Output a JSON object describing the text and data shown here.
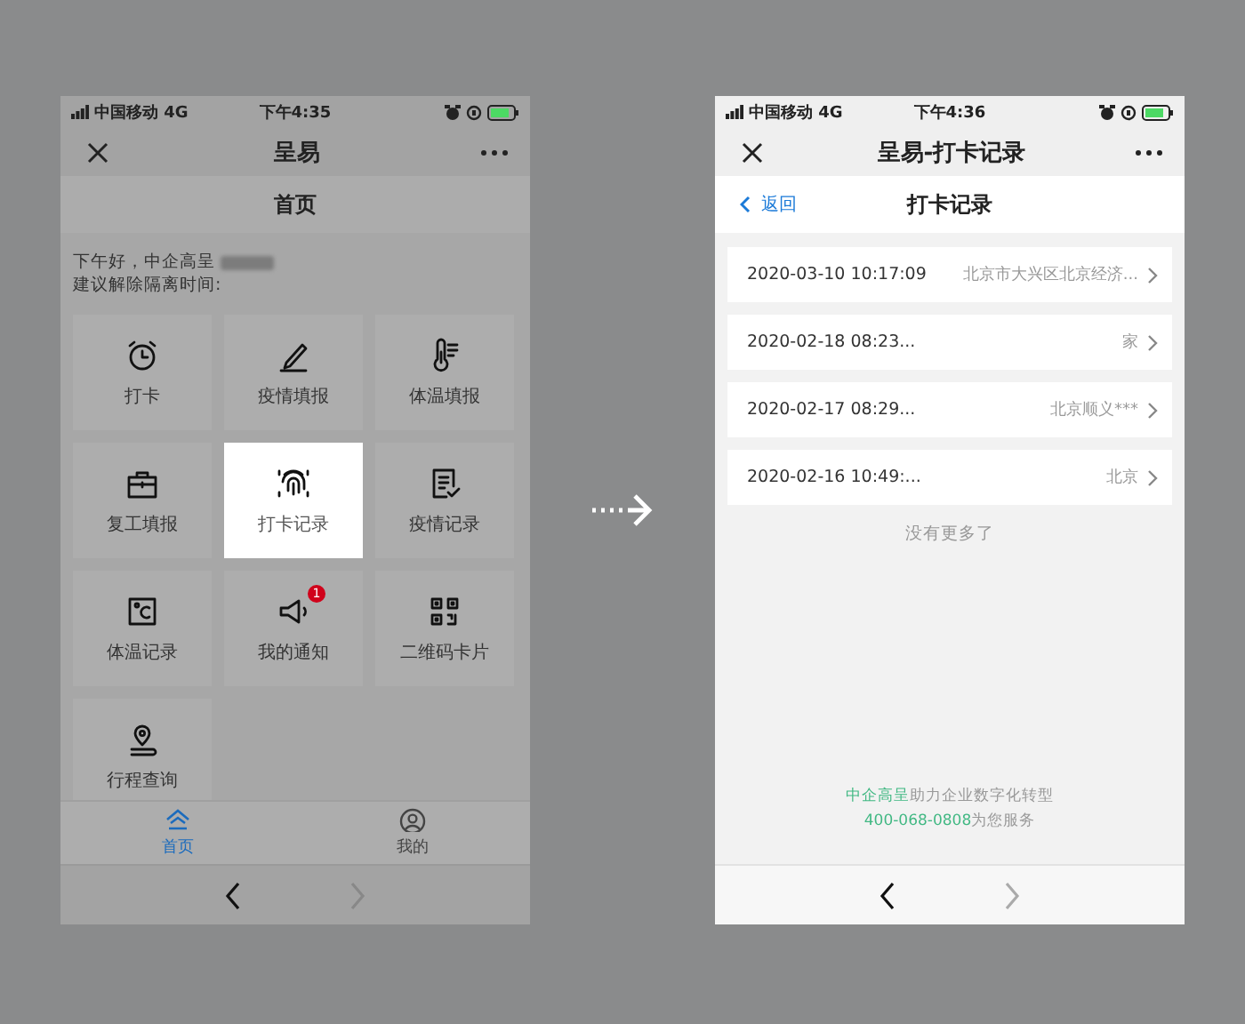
{
  "screens": [
    {
      "kind": "home",
      "dimmed": true,
      "status_bar": {
        "carrier": "中国移动 4G",
        "time": "下午4:35"
      },
      "title": "呈易",
      "nav_title": "首页",
      "greeting": "下午好，中企高呈",
      "advice": "建议解除隔离时间:",
      "tiles": [
        {
          "label": "打卡",
          "highlighted": false
        },
        {
          "label": "疫情填报",
          "highlighted": false
        },
        {
          "label": "体温填报",
          "highlighted": false
        },
        {
          "label": "复工填报",
          "highlighted": false
        },
        {
          "label": "打卡记录",
          "highlighted": true
        },
        {
          "label": "疫情记录",
          "highlighted": false
        },
        {
          "label": "体温记录",
          "highlighted": false
        },
        {
          "label": "我的通知",
          "highlighted": false,
          "badge": "1"
        },
        {
          "label": "二维码卡片",
          "highlighted": false
        },
        {
          "label": "行程查询",
          "highlighted": false
        }
      ],
      "tab_bar": [
        {
          "label": "首页",
          "selected": true
        },
        {
          "label": "我的",
          "selected": false
        }
      ],
      "browser_nav": {
        "back_disabled": false,
        "forward_disabled": true
      }
    },
    {
      "kind": "records",
      "dimmed": false,
      "status_bar": {
        "carrier": "中国移动 4G",
        "time": "下午4:36"
      },
      "title": "呈易-打卡记录",
      "back_label": "返回",
      "nav_title": "打卡记录",
      "records": [
        {
          "time": "2020-03-10 10:17:09",
          "place": "北京市大兴区北京经济..."
        },
        {
          "time": "2020-02-18 08:23...",
          "place": "家"
        },
        {
          "time": "2020-02-17 08:29...",
          "place": "北京顺义***"
        },
        {
          "time": "2020-02-16 10:49:...",
          "place": "北京"
        }
      ],
      "end_note": "没有更多了",
      "footer": [
        {
          "brand": "中企高呈",
          "text": "助力企业数字化转型"
        },
        {
          "brand": "400-068-0808",
          "text": "为您服务"
        }
      ],
      "browser_nav": {
        "back_disabled": false,
        "forward_disabled": true
      }
    }
  ]
}
